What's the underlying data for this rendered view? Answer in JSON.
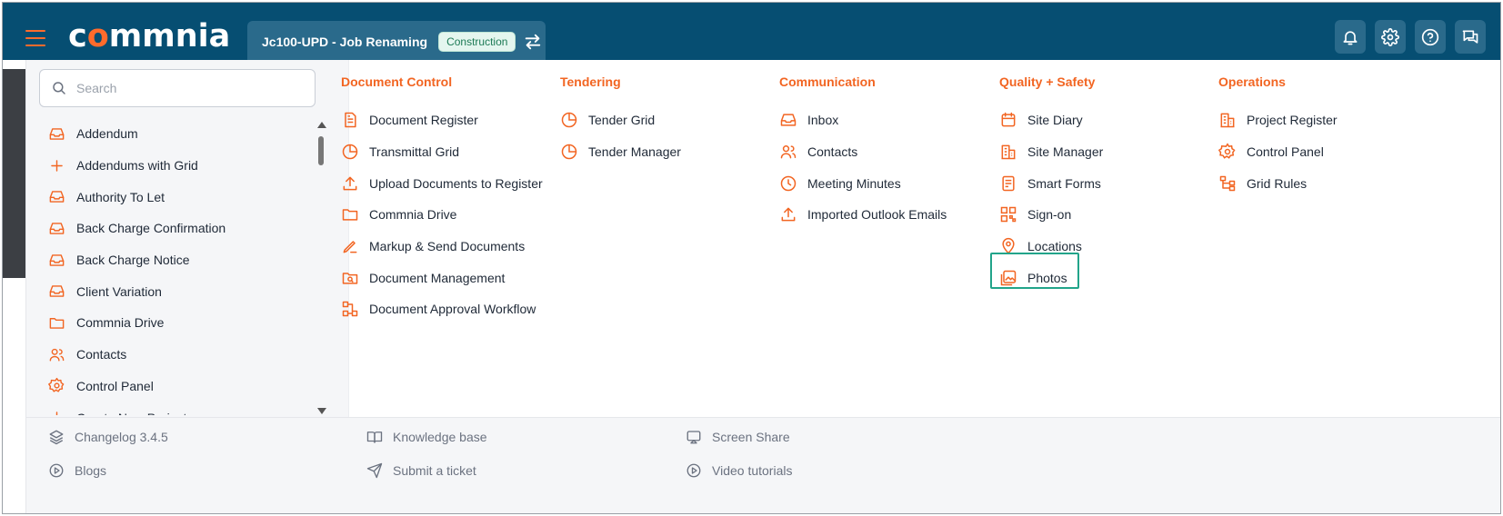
{
  "app": {
    "logo_text_a": "c",
    "logo_text_o": "o",
    "logo_text_b": "mmnia",
    "project_name": "Jc100-UPD - Job Renaming",
    "project_tag": "Construction"
  },
  "colors": {
    "topbar": "#064e72",
    "accent": "#f26522",
    "highlight": "#22a48a"
  },
  "search": {
    "placeholder": "Search"
  },
  "left_list": [
    {
      "label": "Addendum",
      "icon": "inbox-icon"
    },
    {
      "label": "Addendums with Grid",
      "icon": "plus-icon"
    },
    {
      "label": "Authority To Let",
      "icon": "inbox-icon"
    },
    {
      "label": "Back Charge Confirmation",
      "icon": "inbox-icon"
    },
    {
      "label": "Back Charge Notice",
      "icon": "inbox-icon"
    },
    {
      "label": "Client Variation",
      "icon": "inbox-icon"
    },
    {
      "label": "Commnia Drive",
      "icon": "folder-icon"
    },
    {
      "label": "Contacts",
      "icon": "users-icon"
    },
    {
      "label": "Control Panel",
      "icon": "gear-icon"
    },
    {
      "label": "Create New Project",
      "icon": "plus-icon"
    }
  ],
  "columns": {
    "document_control": {
      "title": "Document Control",
      "items": [
        "Document Register",
        "Transmittal Grid",
        "Upload Documents to Register",
        "Commnia Drive",
        "Markup & Send Documents",
        "Document Management",
        "Document Approval Workflow"
      ]
    },
    "tendering": {
      "title": "Tendering",
      "items": [
        "Tender Grid",
        "Tender Manager"
      ]
    },
    "communication": {
      "title": "Communication",
      "items": [
        "Inbox",
        "Contacts",
        "Meeting Minutes",
        "Imported Outlook Emails"
      ]
    },
    "quality_safety": {
      "title": "Quality + Safety",
      "items": [
        "Site Diary",
        "Site Manager",
        "Smart Forms",
        "Sign-on",
        "Locations",
        "Photos"
      ]
    },
    "operations": {
      "title": "Operations",
      "items": [
        "Project Register",
        "Control Panel",
        "Grid Rules"
      ]
    }
  },
  "footer": {
    "changelog": "Changelog 3.4.5",
    "knowledge_base": "Knowledge base",
    "screen_share": "Screen Share",
    "blogs": "Blogs",
    "submit_ticket": "Submit a ticket",
    "video_tutorials": "Video tutorials"
  }
}
